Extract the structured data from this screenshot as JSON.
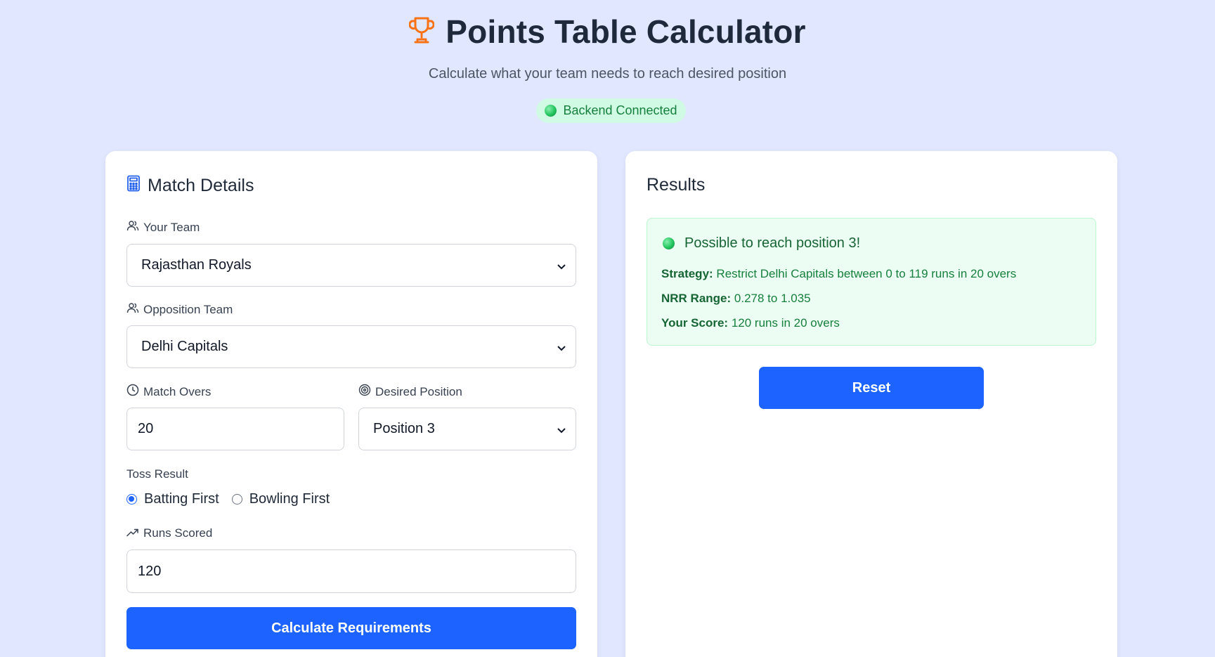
{
  "header": {
    "title": "Points Table Calculator",
    "subtitle": "Calculate what your team needs to reach desired position",
    "status": "Backend Connected",
    "icon": "trophy-icon"
  },
  "colors": {
    "background": "#e0e7ff",
    "primary": "#1d63ff",
    "success_bg": "#ecfdf3",
    "success_text": "#15803d",
    "trophy": "#f97316"
  },
  "match_details": {
    "title": "Match Details",
    "your_team": {
      "label": "Your Team",
      "value": "Rajasthan Royals"
    },
    "opposition_team": {
      "label": "Opposition Team",
      "value": "Delhi Capitals"
    },
    "match_overs": {
      "label": "Match Overs",
      "value": "20"
    },
    "desired_position": {
      "label": "Desired Position",
      "value": "Position 3"
    },
    "toss_result": {
      "label": "Toss Result",
      "options": [
        "Batting First",
        "Bowling First"
      ],
      "selected": "Batting First"
    },
    "runs_scored": {
      "label": "Runs Scored",
      "value": "120"
    },
    "calculate_button": "Calculate Requirements"
  },
  "results": {
    "title": "Results",
    "heading": "Possible to reach position 3!",
    "strategy_label": "Strategy:",
    "strategy_value": "Restrict Delhi Capitals between 0 to 119 runs in 20 overs",
    "nrr_label": "NRR Range:",
    "nrr_value": "0.278 to 1.035",
    "score_label": "Your Score:",
    "score_value": "120 runs in 20 overs",
    "reset_button": "Reset"
  }
}
